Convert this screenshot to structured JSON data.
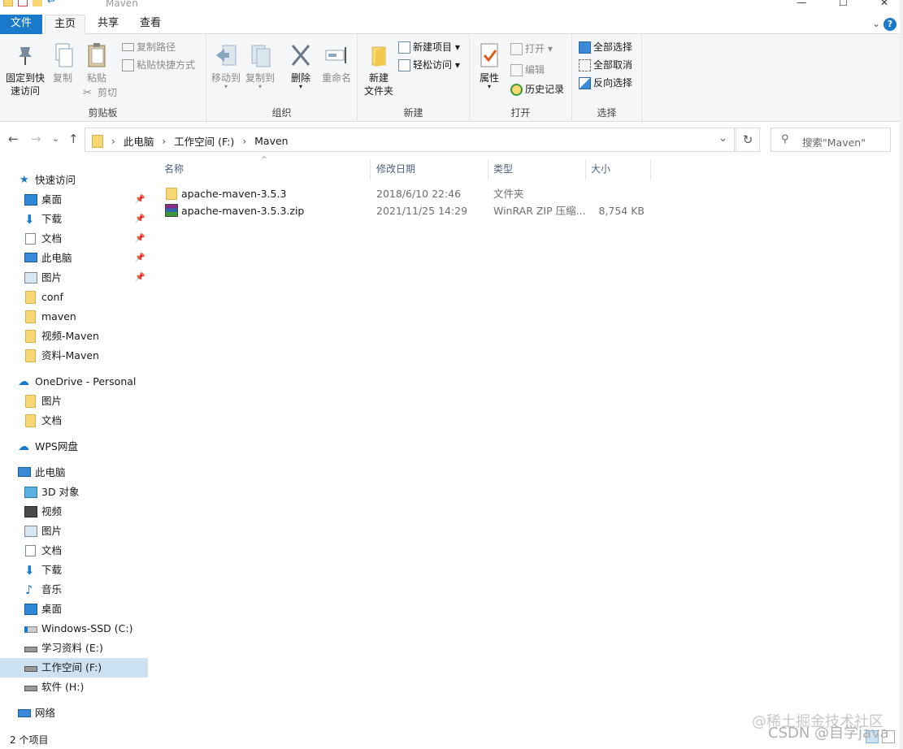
{
  "window": {
    "title": "Maven",
    "controls": [
      "—",
      "☐",
      "✕"
    ]
  },
  "tabs": {
    "file": "文件",
    "home": "主页",
    "share": "共享",
    "view": "查看",
    "help": "?",
    "collapse": "⌄"
  },
  "ribbon": {
    "clipboard": {
      "label": "剪贴板",
      "pin_line1": "固定到快",
      "pin_line2": "速访问",
      "copy": "复制",
      "paste": "粘贴",
      "copy_path": "复制路径",
      "paste_shortcut": "粘贴快捷方式",
      "cut": "剪切"
    },
    "organize": {
      "label": "组织",
      "move_to": "移动到",
      "copy_to": "复制到",
      "delete": "删除",
      "rename": "重命名"
    },
    "new": {
      "label": "新建",
      "new_folder_line1": "新建",
      "new_folder_line2": "文件夹",
      "new_item": "新建项目 ▾",
      "easy_access": "轻松访问 ▾"
    },
    "open": {
      "label": "打开",
      "properties": "属性",
      "open": "打开 ▾",
      "edit": "编辑",
      "history": "历史记录"
    },
    "select": {
      "label": "选择",
      "select_all": "全部选择",
      "select_none": "全部取消",
      "invert": "反向选择"
    }
  },
  "nav": {
    "back": "←",
    "forward": "→",
    "recent": "⌄",
    "up": "↑",
    "breadcrumbs": [
      "此电脑",
      "工作空间 (F:)",
      "Maven"
    ],
    "sep": "›",
    "refresh": "↻",
    "search_placeholder": "搜索\"Maven\""
  },
  "sidebar": {
    "quick_access": "快速访问",
    "quick_items": [
      {
        "label": "桌面",
        "icon": "desktop-icon",
        "pinned": true
      },
      {
        "label": "下载",
        "icon": "download-icon",
        "pinned": true
      },
      {
        "label": "文档",
        "icon": "document-icon",
        "pinned": true
      },
      {
        "label": "此电脑",
        "icon": "computer-icon",
        "pinned": true
      },
      {
        "label": "图片",
        "icon": "picture-icon",
        "pinned": true
      },
      {
        "label": "conf",
        "icon": "folder-icon",
        "pinned": false
      },
      {
        "label": "maven",
        "icon": "folder-icon",
        "pinned": false
      },
      {
        "label": "视频-Maven",
        "icon": "folder-icon",
        "pinned": false
      },
      {
        "label": "资料-Maven",
        "icon": "folder-icon",
        "pinned": false
      }
    ],
    "onedrive": "OneDrive - Personal",
    "onedrive_items": [
      "图片",
      "文档"
    ],
    "wps": "WPS网盘",
    "this_pc": "此电脑",
    "pc_items": [
      {
        "label": "3D 对象",
        "icon": "3d-objects-icon"
      },
      {
        "label": "视频",
        "icon": "video-icon"
      },
      {
        "label": "图片",
        "icon": "picture-icon"
      },
      {
        "label": "文档",
        "icon": "document-icon"
      },
      {
        "label": "下载",
        "icon": "download-icon"
      },
      {
        "label": "音乐",
        "icon": "music-icon"
      },
      {
        "label": "桌面",
        "icon": "desktop-icon"
      },
      {
        "label": "Windows-SSD (C:)",
        "icon": "windows-drive-icon"
      },
      {
        "label": "学习资料 (E:)",
        "icon": "drive-icon"
      },
      {
        "label": "工作空间 (F:)",
        "icon": "drive-icon",
        "selected": true
      },
      {
        "label": "软件 (H:)",
        "icon": "drive-icon"
      }
    ],
    "network": "网络"
  },
  "columns": {
    "name": "名称",
    "date": "修改日期",
    "type": "类型",
    "size": "大小",
    "sort_indicator": "^"
  },
  "files": [
    {
      "name": "apache-maven-3.5.3",
      "date": "2018/6/10 22:46",
      "type": "文件夹",
      "size": "",
      "icon": "folder-icon"
    },
    {
      "name": "apache-maven-3.5.3.zip",
      "date": "2021/11/25 14:29",
      "type": "WinRAR ZIP 压缩...",
      "size": "8,754 KB",
      "icon": "winrar-icon"
    }
  ],
  "status": {
    "count": "2 个项目"
  },
  "watermark": {
    "line1": "@稀土掘金技术社区",
    "line2": "CSDN @自学java"
  },
  "colors": {
    "accent": "#1979ca",
    "selected_bg": "#cce1f2",
    "ribbon_bg": "#f5f6f7",
    "folder": "#f8d775"
  }
}
